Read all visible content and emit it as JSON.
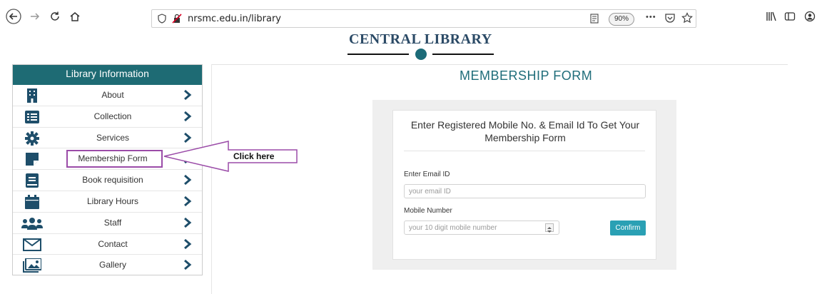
{
  "browser": {
    "url": "nrsmc.edu.in/library",
    "zoom": "90%",
    "more_label": "•••"
  },
  "page": {
    "brand": "CENTRAL LIBRARY"
  },
  "sidebar": {
    "heading": "Library Information",
    "items": [
      {
        "label": "About",
        "icon": "building-icon"
      },
      {
        "label": "Collection",
        "icon": "list-icon"
      },
      {
        "label": "Services",
        "icon": "gear-icon"
      },
      {
        "label": "Membership Form",
        "icon": "sticky-note-icon"
      },
      {
        "label": "Book requisition",
        "icon": "book-icon"
      },
      {
        "label": "Library Hours",
        "icon": "calendar-icon"
      },
      {
        "label": "Staff",
        "icon": "users-icon"
      },
      {
        "label": "Contact",
        "icon": "envelope-icon"
      },
      {
        "label": "Gallery",
        "icon": "images-icon"
      }
    ]
  },
  "callout": {
    "text": "Click here"
  },
  "form": {
    "title": "MEMBERSHIP FORM",
    "heading": "Enter Registered Mobile No. & Email Id To Get Your Membership Form",
    "email_label": "Enter Email ID",
    "email_placeholder": "your email ID",
    "mobile_label": "Mobile Number",
    "mobile_placeholder": "your 10 digit mobile number",
    "confirm_label": "Confirm"
  },
  "colors": {
    "accent": "#1e6b74",
    "button": "#2aa0b4",
    "highlight": "#9b4ca8",
    "title": "#1f6d7a"
  }
}
